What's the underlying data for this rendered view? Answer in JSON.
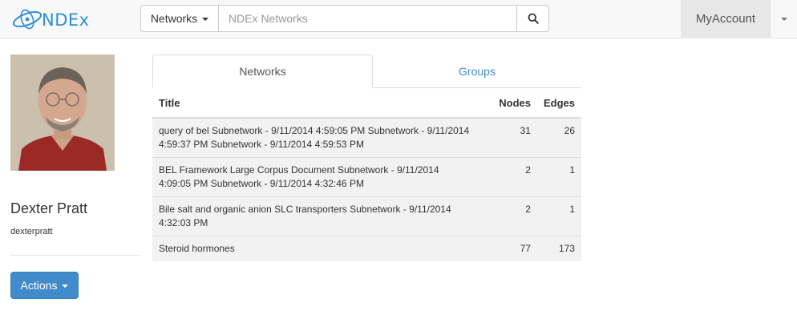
{
  "navbar": {
    "brand": "NDEx",
    "search_type": "Networks",
    "search_placeholder": "NDEx Networks",
    "account_label": "MyAccount"
  },
  "profile": {
    "name": "Dexter Pratt",
    "username": "dexterpratt",
    "actions_label": "Actions"
  },
  "tabs": [
    {
      "label": "Networks",
      "active": true
    },
    {
      "label": "Groups",
      "active": false
    }
  ],
  "table": {
    "headers": {
      "title": "Title",
      "nodes": "Nodes",
      "edges": "Edges"
    },
    "rows": [
      {
        "title": "query of bel Subnetwork - 9/11/2014 4:59:05 PM Subnetwork - 9/11/2014 4:59:37 PM Subnetwork - 9/11/2014 4:59:53 PM",
        "nodes": "31",
        "edges": "26"
      },
      {
        "title": "BEL Framework Large Corpus Document Subnetwork - 9/11/2014 4:09:05 PM Subnetwork - 9/11/2014 4:32:46 PM",
        "nodes": "2",
        "edges": "1"
      },
      {
        "title": "Bile salt and organic anion SLC transporters Subnetwork - 9/11/2014 4:32:03 PM",
        "nodes": "2",
        "edges": "1"
      },
      {
        "title": "Steroid hormones",
        "nodes": "77",
        "edges": "173"
      }
    ]
  },
  "colors": {
    "brand": "#2d8fd8",
    "link": "#428bca",
    "primary_button": "#428bca",
    "navbar_bg": "#f8f8f8",
    "row_stripe": "#f2f2f2"
  },
  "icons": {
    "logo": "ndex-logo-icon",
    "search": "search-icon",
    "caret": "caret-down-icon"
  }
}
